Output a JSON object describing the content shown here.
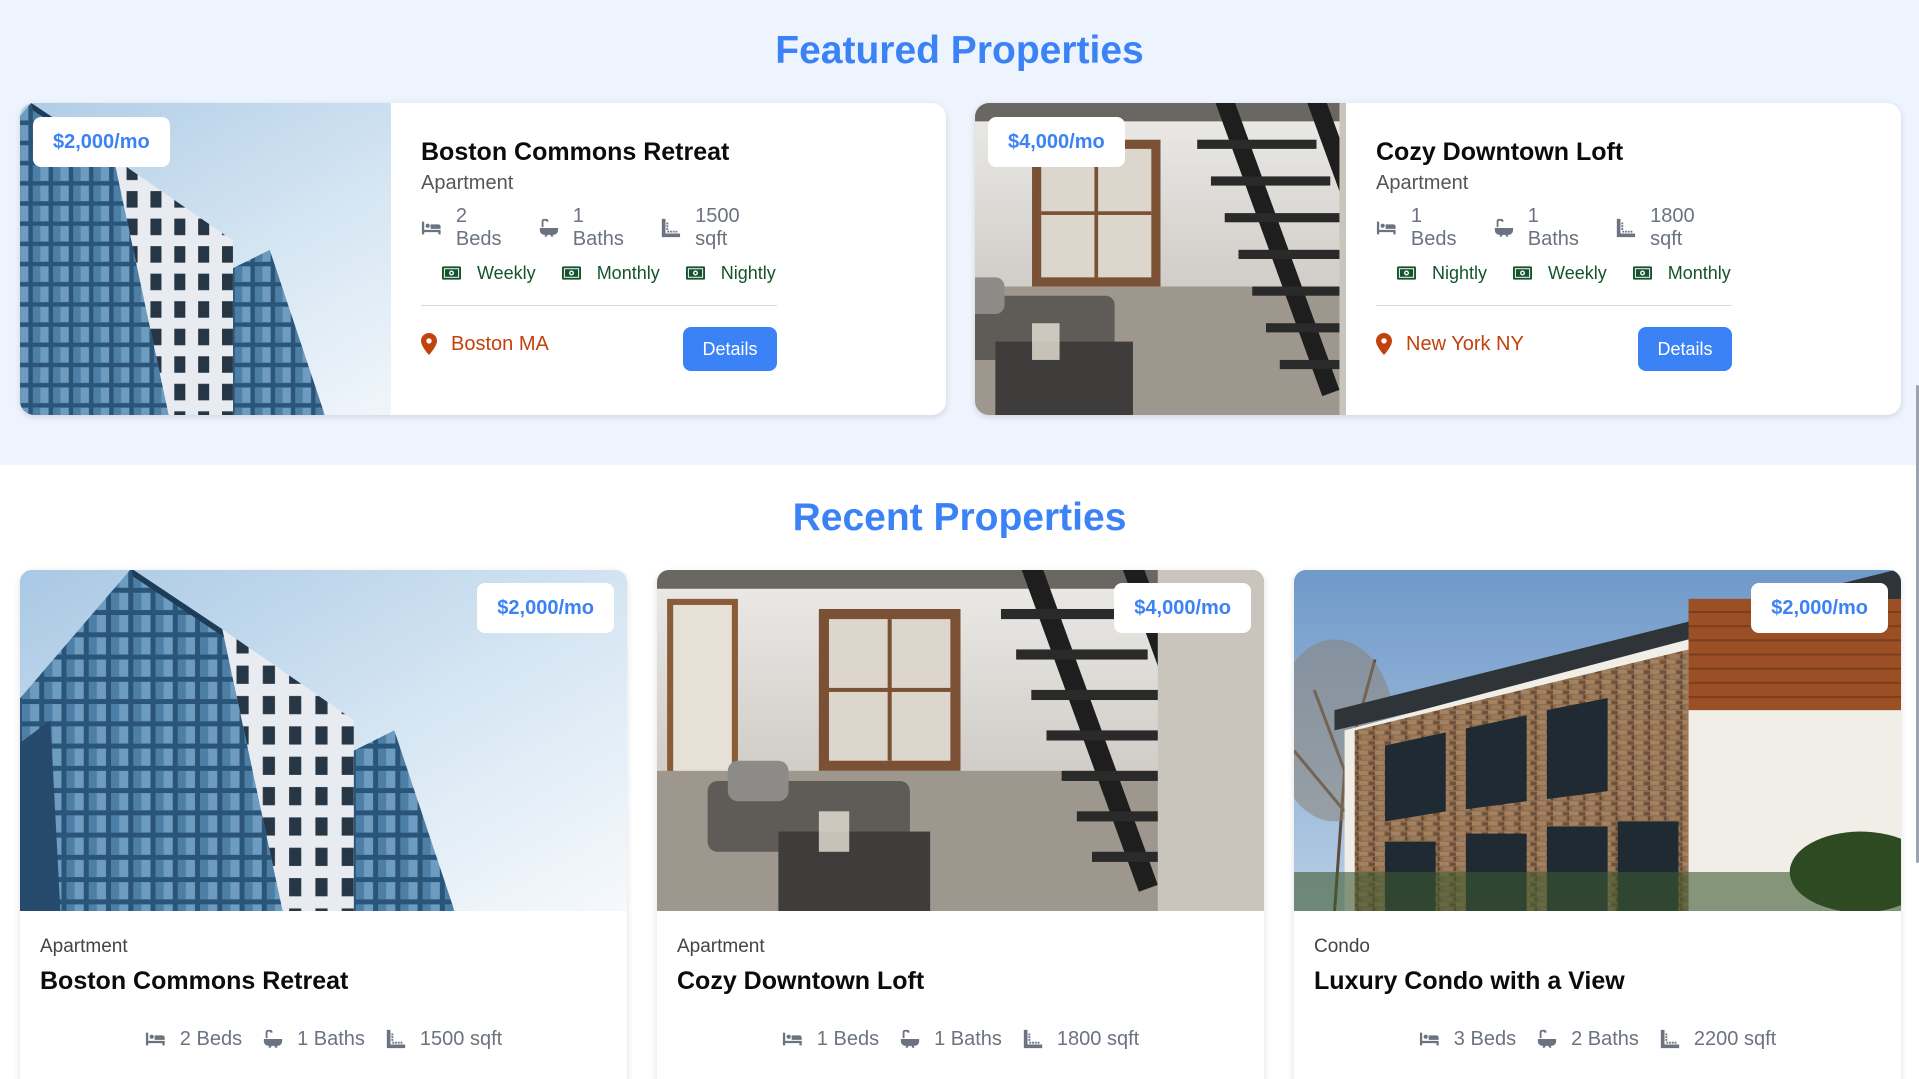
{
  "featured": {
    "title": "Featured Properties",
    "cards": [
      {
        "price": "$2,000/mo",
        "name": "Boston Commons Retreat",
        "type": "Apartment",
        "beds": "2 Beds",
        "baths": "1 Baths",
        "sqft": "1500 sqft",
        "rates": [
          "Weekly",
          "Monthly",
          "Nightly"
        ],
        "location": "Boston MA",
        "button": "Details"
      },
      {
        "price": "$4,000/mo",
        "name": "Cozy Downtown Loft",
        "type": "Apartment",
        "beds": "1 Beds",
        "baths": "1 Baths",
        "sqft": "1800 sqft",
        "rates": [
          "Nightly",
          "Weekly",
          "Monthly"
        ],
        "location": "New York NY",
        "button": "Details"
      }
    ]
  },
  "recent": {
    "title": "Recent Properties",
    "cards": [
      {
        "price": "$2,000/mo",
        "type": "Apartment",
        "name": "Boston Commons Retreat",
        "beds": "2 Beds",
        "baths": "1 Baths",
        "sqft": "1500 sqft"
      },
      {
        "price": "$4,000/mo",
        "type": "Apartment",
        "name": "Cozy Downtown Loft",
        "beds": "1 Beds",
        "baths": "1 Baths",
        "sqft": "1800 sqft"
      },
      {
        "price": "$2,000/mo",
        "type": "Condo",
        "name": "Luxury Condo with a View",
        "beds": "3 Beds",
        "baths": "2 Baths",
        "sqft": "2200 sqft"
      }
    ]
  },
  "colors": {
    "accent": "#3b82f6",
    "featured_background": "#eef4fd",
    "location": "#c2410c",
    "rate": "#14532d"
  },
  "icons": [
    "bed-icon",
    "bath-icon",
    "ruler-icon",
    "money-icon",
    "map-marker-icon"
  ]
}
